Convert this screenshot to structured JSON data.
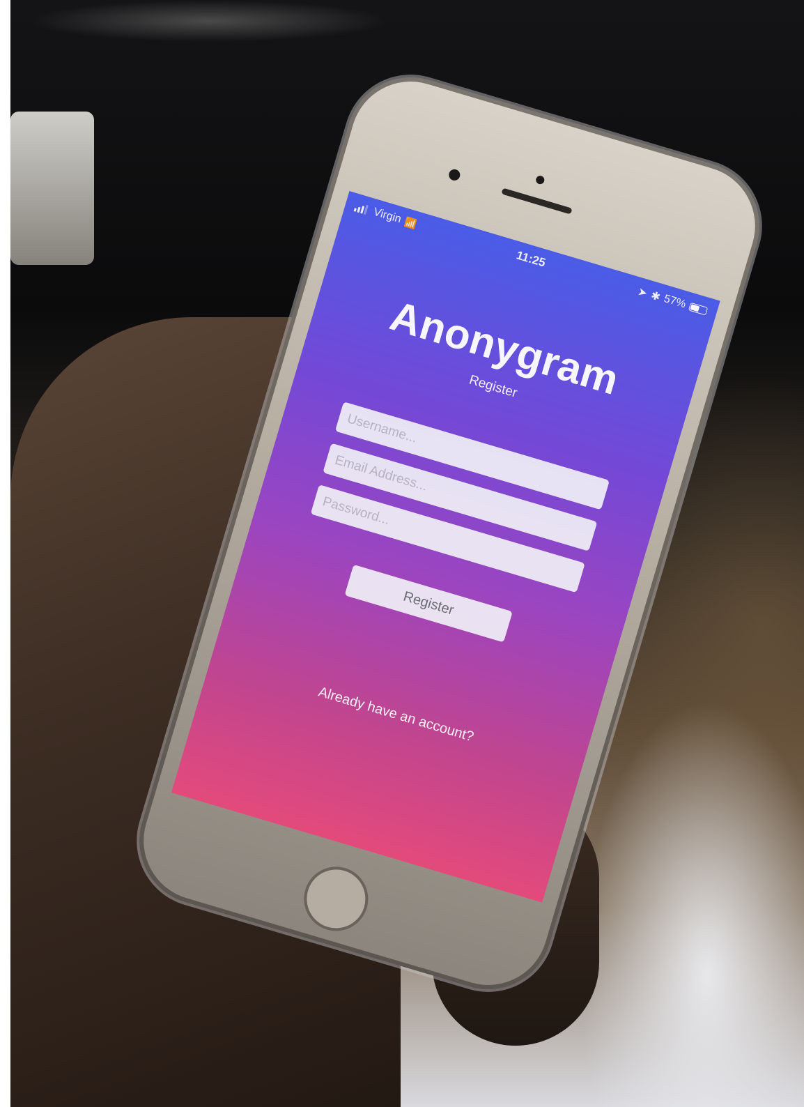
{
  "status_bar": {
    "carrier": "Virgin",
    "time": "11:25",
    "battery_percent": "57%",
    "battery_level": 0.57,
    "icons": [
      "signal-icon",
      "wifi-icon",
      "location-icon",
      "bluetooth-icon",
      "battery-icon"
    ]
  },
  "app": {
    "title": "Anonygram",
    "subtitle": "Register"
  },
  "form": {
    "username_placeholder": "Username...",
    "email_placeholder": "Email Address...",
    "password_placeholder": "Password...",
    "register_label": "Register"
  },
  "footer": {
    "login_link": "Already have an account?"
  },
  "colors": {
    "gradient_top": "#4a5ce6",
    "gradient_mid": "#9b45c0",
    "gradient_bottom": "#e34a7b",
    "field_background": "#f0f0f6"
  }
}
